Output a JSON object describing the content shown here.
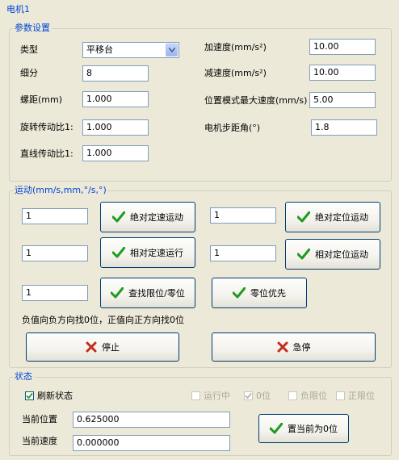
{
  "window": {
    "title": "电机1"
  },
  "params": {
    "group_label": "参数设置",
    "type": {
      "label": "类型",
      "value": "平移台"
    },
    "subdivision": {
      "label": "细分",
      "value": "8"
    },
    "pitch": {
      "label": "螺距(mm)",
      "value": "1.000"
    },
    "rot_ratio": {
      "label": "旋转传动比1:",
      "value": "1.000"
    },
    "lin_ratio": {
      "label": "直线传动比1:",
      "value": "1.000"
    },
    "accel": {
      "label": "加速度(mm/s²)",
      "value": "10.00"
    },
    "decel": {
      "label": "减速度(mm/s²)",
      "value": "10.00"
    },
    "max_speed": {
      "label": "位置模式最大速度(mm/s)",
      "value": "5.00"
    },
    "step_angle": {
      "label": "电机步距角(°)",
      "value": "1.8"
    }
  },
  "motion": {
    "group_label": "运动(mm/s,mm,°/s,°)",
    "abs_speed": {
      "value": "1",
      "button": "绝对定速运动"
    },
    "abs_pos": {
      "value": "1",
      "button": "绝对定位运动"
    },
    "rel_speed": {
      "value": "1",
      "button": "相对定速运行"
    },
    "rel_pos": {
      "value": "1",
      "button": "相对定位运动"
    },
    "find_limit": {
      "value": "1",
      "button": "查找限位/零位"
    },
    "zero_first_button": "零位优先",
    "hint": "负值向负方向找0位，正值向正方向找0位",
    "stop_button": "停止",
    "estop_button": "急停"
  },
  "status": {
    "group_label": "状态",
    "refresh": {
      "label": "刷新状态",
      "checked": true
    },
    "running": {
      "label": "运行中",
      "checked": false
    },
    "zero": {
      "label": "0位",
      "checked": true
    },
    "neg_limit": {
      "label": "负限位",
      "checked": false
    },
    "pos_limit": {
      "label": "正限位",
      "checked": false
    },
    "current_pos": {
      "label": "当前位置",
      "value": "0.625000"
    },
    "current_speed": {
      "label": "当前速度",
      "value": "0.000000"
    },
    "set_zero_button": "置当前为0位"
  },
  "colors": {
    "accent": "#0046d5",
    "check_icon": "#1f9b1f",
    "x_icon": "#c42b1c"
  }
}
